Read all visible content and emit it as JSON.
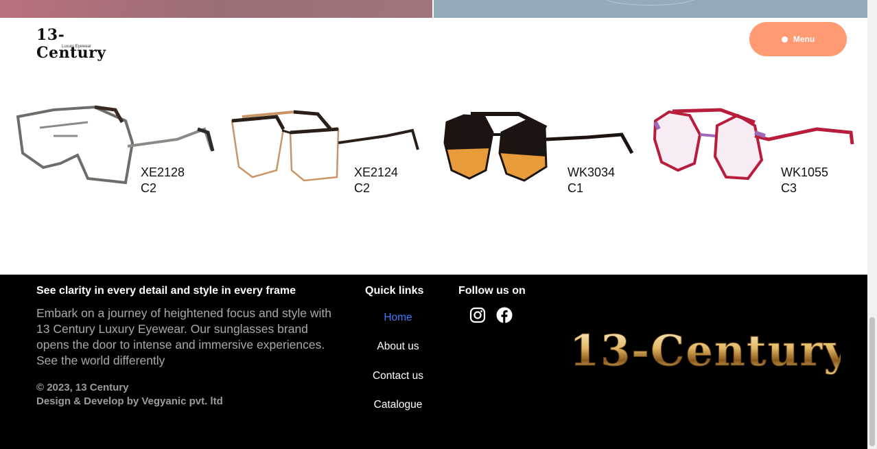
{
  "brand": {
    "name": "13-Century",
    "tagline": "Luxury Eyewear"
  },
  "header": {
    "menu_label": "Menu",
    "menu_color": "#ff9a73"
  },
  "products": [
    {
      "model": "XE2128",
      "color_code": "C2",
      "frame_color": "#8c8a86"
    },
    {
      "model": "XE2124",
      "color_code": "C2",
      "frame_color": "#2a1e18"
    },
    {
      "model": "WK3034",
      "color_code": "C1",
      "frame_color": "#e89b3a"
    },
    {
      "model": "WK1055",
      "color_code": "C3",
      "frame_color": "#b81d3b"
    }
  ],
  "footer": {
    "tagline_heading": "See clarity in every detail and style in every frame",
    "description": "Embark on a journey of heightened focus and style with 13 Century Luxury Eyewear. Our sunglasses brand opens the door to intense and immersive experiences. See the world differently",
    "copyright": "© 2023, 13 Century",
    "credit": "Design & Develop by Vegyanic pvt. ltd",
    "quick_links_heading": "Quick links",
    "links": [
      "Home",
      "About us",
      "Contact us",
      "Catalogue"
    ],
    "follow_heading": "Follow us on",
    "social": [
      "instagram-icon",
      "facebook-icon"
    ],
    "logo_text": "13-Century"
  }
}
